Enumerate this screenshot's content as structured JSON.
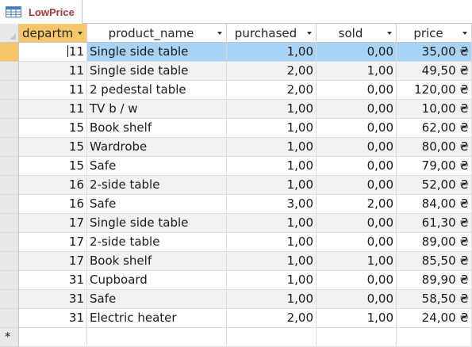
{
  "tab": {
    "title": "LowPrice",
    "icon": "table-icon"
  },
  "columns": [
    {
      "key": "department",
      "label": "departm"
    },
    {
      "key": "product_name",
      "label": "product_name"
    },
    {
      "key": "purchased",
      "label": "purchased"
    },
    {
      "key": "sold",
      "label": "sold"
    },
    {
      "key": "price",
      "label": "price"
    }
  ],
  "rows": [
    {
      "department": "11",
      "product_name": "Single side table",
      "purchased": "1,00",
      "sold": "0,00",
      "price": "35,00 ₴"
    },
    {
      "department": "11",
      "product_name": "Single side table",
      "purchased": "2,00",
      "sold": "1,00",
      "price": "49,50 ₴"
    },
    {
      "department": "11",
      "product_name": "2 pedestal table",
      "purchased": "2,00",
      "sold": "0,00",
      "price": "120,00 ₴"
    },
    {
      "department": "11",
      "product_name": "TV b / w",
      "purchased": "1,00",
      "sold": "0,00",
      "price": "10,00 ₴"
    },
    {
      "department": "15",
      "product_name": "Book shelf",
      "purchased": "1,00",
      "sold": "0,00",
      "price": "62,00 ₴"
    },
    {
      "department": "15",
      "product_name": "Wardrobe",
      "purchased": "1,00",
      "sold": "0,00",
      "price": "80,00 ₴"
    },
    {
      "department": "15",
      "product_name": "Safe",
      "purchased": "1,00",
      "sold": "0,00",
      "price": "79,00 ₴"
    },
    {
      "department": "16",
      "product_name": "2-side table",
      "purchased": "1,00",
      "sold": "0,00",
      "price": "52,00 ₴"
    },
    {
      "department": "16",
      "product_name": "Safe",
      "purchased": "3,00",
      "sold": "2,00",
      "price": "84,00 ₴"
    },
    {
      "department": "17",
      "product_name": "Single side table",
      "purchased": "1,00",
      "sold": "0,00",
      "price": "61,30 ₴"
    },
    {
      "department": "17",
      "product_name": "2-side table",
      "purchased": "1,00",
      "sold": "0,00",
      "price": "89,00 ₴"
    },
    {
      "department": "17",
      "product_name": "Book shelf",
      "purchased": "1,00",
      "sold": "1,00",
      "price": "85,50 ₴"
    },
    {
      "department": "31",
      "product_name": "Cupboard",
      "purchased": "1,00",
      "sold": "0,00",
      "price": "89,90 ₴"
    },
    {
      "department": "31",
      "product_name": "Safe",
      "purchased": "1,00",
      "sold": "0,00",
      "price": "58,50 ₴"
    },
    {
      "department": "31",
      "product_name": "Electric heater",
      "purchased": "2,00",
      "sold": "1,00",
      "price": "24,00 ₴"
    }
  ],
  "new_record_marker": "*",
  "colors": {
    "tab_title": "#a4373a",
    "active_header": "#f6c66b",
    "selected_row": "#a9d3f5",
    "alt_row": "#f2f2f2"
  }
}
